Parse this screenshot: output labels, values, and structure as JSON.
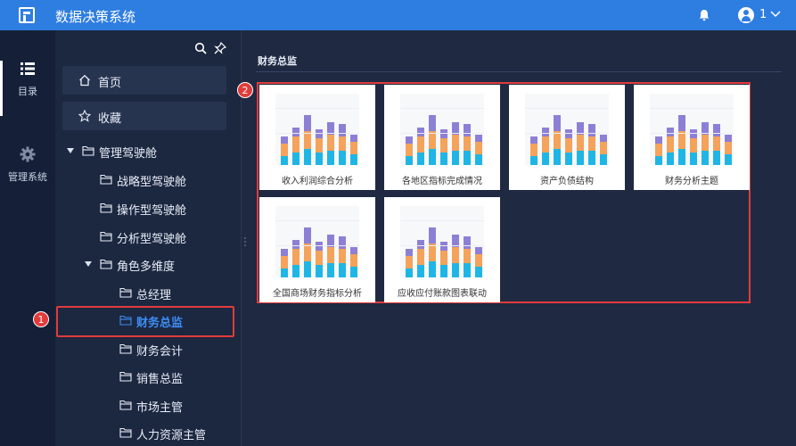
{
  "header": {
    "app_title": "数据决策系统",
    "user_name": "1"
  },
  "rail": {
    "items": [
      {
        "label": "目录",
        "icon": "list-icon"
      },
      {
        "label": "管理系统",
        "icon": "gear-icon"
      }
    ]
  },
  "tree": {
    "quick": [
      {
        "label": "首页",
        "icon": "home-icon"
      },
      {
        "label": "收藏",
        "icon": "star-icon"
      }
    ],
    "nodes": [
      {
        "label": "管理驾驶舱",
        "level": 0,
        "expanded": true
      },
      {
        "label": "战略型驾驶舱",
        "level": 1
      },
      {
        "label": "操作型驾驶舱",
        "level": 1
      },
      {
        "label": "分析型驾驶舱",
        "level": 1
      },
      {
        "label": "角色多维度",
        "level": 1,
        "expanded": true
      },
      {
        "label": "总经理",
        "level": 2
      },
      {
        "label": "财务总监",
        "level": 2,
        "selected": true
      },
      {
        "label": "财务会计",
        "level": 2
      },
      {
        "label": "销售总监",
        "level": 2
      },
      {
        "label": "市场主管",
        "level": 2
      },
      {
        "label": "人力资源主管",
        "level": 2
      }
    ]
  },
  "annotations": {
    "badge_1": "1",
    "badge_2": "2"
  },
  "main": {
    "title": "财务总监",
    "cards": [
      {
        "title": "收入利润综合分析"
      },
      {
        "title": "各地区指标完成情况"
      },
      {
        "title": "资产负债结构"
      },
      {
        "title": "财务分析主题"
      },
      {
        "title": "全国商场财务指标分析"
      },
      {
        "title": "应收应付账款图表联动"
      }
    ]
  },
  "colors": {
    "topbar": "#2e7de0",
    "selected": "#3d8df5",
    "annotation": "#e23b3b",
    "thumb_purple": "#8e7fd6",
    "thumb_orange": "#f5a25a",
    "thumb_cyan": "#1fb6e6"
  }
}
